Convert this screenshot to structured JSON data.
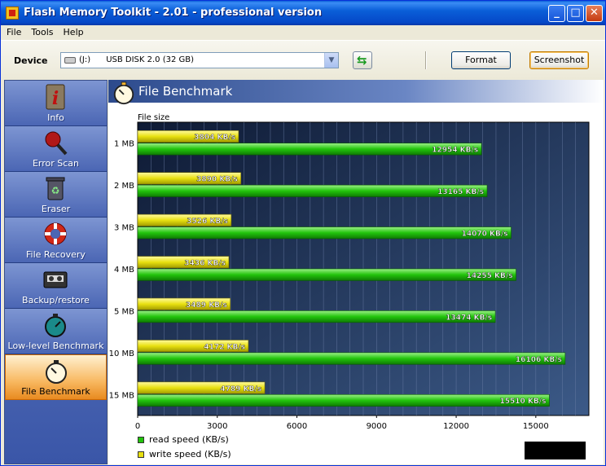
{
  "window": {
    "title": "Flash Memory Toolkit - 2.01 - professional version",
    "controls": {
      "minimize": "_",
      "maximize": "□",
      "close": "✕"
    }
  },
  "menu": [
    "File",
    "Tools",
    "Help"
  ],
  "device": {
    "label": "Device",
    "drive": "(J:)",
    "name": "USB DISK 2.0 (32 GB)",
    "format_label": "Format",
    "screenshot_label": "Screenshot"
  },
  "sidebar": {
    "items": [
      {
        "label": "Info",
        "icon": "info-icon"
      },
      {
        "label": "Error Scan",
        "icon": "magnifier-icon"
      },
      {
        "label": "Eraser",
        "icon": "recycle-bin-icon"
      },
      {
        "label": "File Recovery",
        "icon": "lifebuoy-icon"
      },
      {
        "label": "Backup/restore",
        "icon": "cassette-icon"
      },
      {
        "label": "Low-level Benchmark",
        "icon": "stopwatch-icon"
      },
      {
        "label": "File Benchmark",
        "icon": "stopwatch-icon"
      }
    ],
    "selected": 6
  },
  "panel": {
    "title": "File Benchmark"
  },
  "colors": {
    "read": "#22c40c",
    "write": "#e8e010",
    "plot_bg": "#1e2f52"
  },
  "chart_data": {
    "type": "bar",
    "orientation": "horizontal",
    "title": "",
    "ylabel": "File size",
    "categories": [
      "1 MB",
      "2 MB",
      "3 MB",
      "4 MB",
      "5 MB",
      "10 MB",
      "15 MB"
    ],
    "series": [
      {
        "name": "write speed (KB/s)",
        "values": [
          3804,
          3890,
          3526,
          3436,
          3489,
          4172,
          4789
        ]
      },
      {
        "name": "read speed (KB/s)",
        "values": [
          12954,
          13165,
          14070,
          14255,
          13474,
          16106,
          15510
        ]
      }
    ],
    "data_labels": {
      "write": [
        "3804 KB/s",
        "3890 KB/s",
        "3526 KB/s",
        "3436 KB/s",
        "3489 KB/s",
        "4172 KB/s",
        "4789 KB/s"
      ],
      "read": [
        "12954 KB/s",
        "13165 KB/s",
        "14070 KB/s",
        "14255 KB/s",
        "13474 KB/s",
        "16106 KB/s",
        "15510 KB/s"
      ]
    },
    "x_ticks": [
      "0",
      "3000",
      "6000",
      "9000",
      "12000",
      "15000"
    ],
    "xlim": [
      0,
      17000
    ],
    "grid": true,
    "legend": [
      "read speed (KB/s)",
      "write speed (KB/s)"
    ],
    "legend_position": "bottom-left"
  }
}
